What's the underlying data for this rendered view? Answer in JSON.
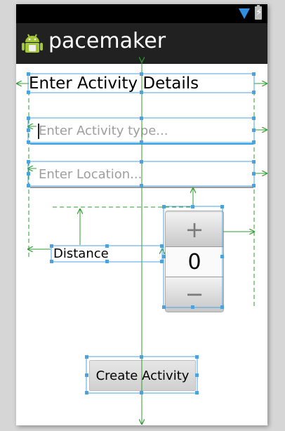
{
  "app": {
    "title": "pacemaker"
  },
  "form": {
    "heading": "Enter Activity Details",
    "activity_type_placeholder": "Enter Activity type...",
    "location_placeholder": "Enter Location...",
    "distance_label": "Distance",
    "distance_value": "0",
    "increment_symbol": "+",
    "decrement_symbol": "−",
    "create_button": "Create Activity"
  },
  "colors": {
    "action_bar": "#212121",
    "status_bar": "#000000",
    "accent": "#35a0e0",
    "guide_green": "#2e9d2e",
    "selection_blue": "#4aa3df"
  },
  "icons": {
    "app_icon": "android-icon",
    "wifi": "wifi-icon",
    "battery": "battery-charging-icon"
  }
}
